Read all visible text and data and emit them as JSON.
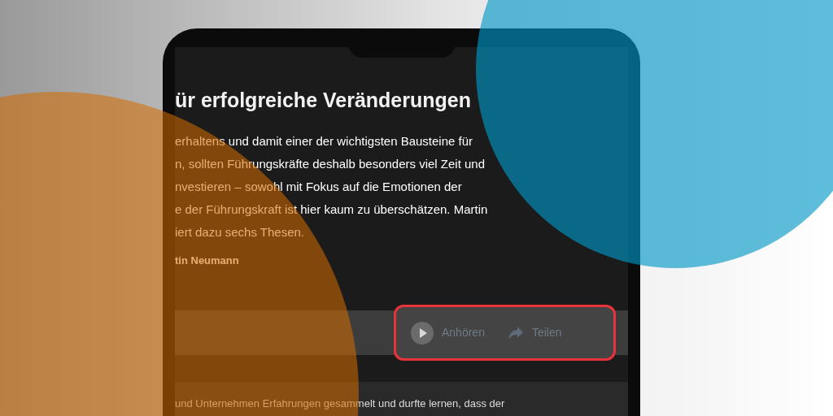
{
  "article": {
    "title": "ür erfolgreiche Veränderungen",
    "lines": [
      "erhaltens und damit einer der wichtigsten Bausteine für",
      "n, sollten Führungskräfte deshalb besonders viel Zeit und",
      "nvestieren – sowohl mit Fokus auf die Emotionen der",
      "e der Führungskraft ist hier kaum zu überschätzen. Martin",
      "iert dazu sechs Thesen."
    ],
    "author": "tin Neumann"
  },
  "toolbar": {
    "highlighted": true,
    "actions": [
      {
        "kind": "listen",
        "label": "Anhören"
      },
      {
        "kind": "share",
        "label": "Teilen"
      }
    ]
  },
  "next_paragraph": "und Unternehmen Erfahrungen gesammelt und durfte lernen, dass der"
}
